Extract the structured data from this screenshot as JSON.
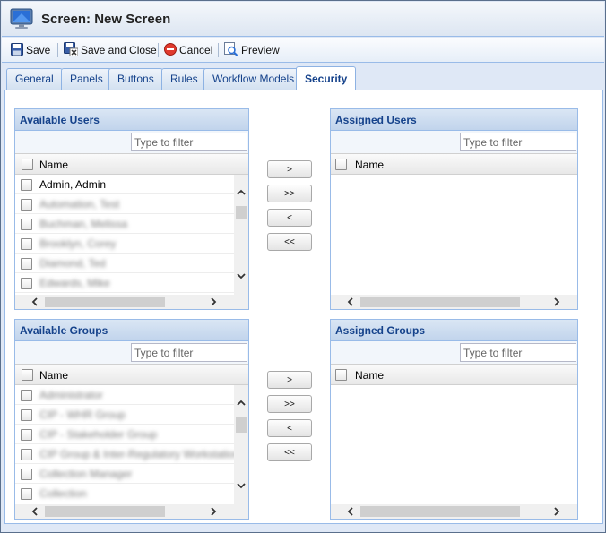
{
  "title": "Screen: New Screen",
  "toolbar": {
    "save": "Save",
    "save_close": "Save and Close",
    "cancel": "Cancel",
    "preview": "Preview"
  },
  "tabs": [
    "General",
    "Panels",
    "Buttons",
    "Rules",
    "Workflow Models",
    "Security"
  ],
  "active_tab": "Security",
  "available_users": {
    "title": "Available Users",
    "filter_placeholder": "Type to filter",
    "column": "Name",
    "rows": [
      "Admin, Admin",
      "Automation, Test",
      "Buchman, Melissa",
      "Brooklyn, Corey",
      "Diamond, Ted",
      "Edwards, Mike"
    ]
  },
  "assigned_users": {
    "title": "Assigned Users",
    "filter_placeholder": "Type to filter",
    "column": "Name"
  },
  "available_groups": {
    "title": "Available Groups",
    "filter_placeholder": "Type to filter",
    "column": "Name",
    "rows": [
      "Administrator",
      "CIP - WHR Group",
      "CIP - Stakeholder Group",
      "CIP Group & Inter-Regulatory Workstation",
      "Collection Manager",
      "Collection"
    ]
  },
  "assigned_groups": {
    "title": "Assigned Groups",
    "filter_placeholder": "Type to filter",
    "column": "Name"
  },
  "move_buttons": {
    "add": ">",
    "add_all": ">>",
    "remove": "<",
    "remove_all": "<<"
  }
}
